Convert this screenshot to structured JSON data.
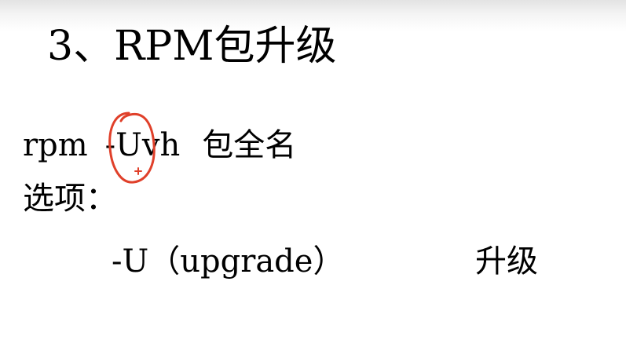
{
  "slide": {
    "title": "3、RPM包升级",
    "command": {
      "program": "rpm",
      "flags": "-Uvh",
      "argument": "包全名"
    },
    "options_label": "选项：",
    "option": {
      "flag": "-U（upgrade）",
      "description": "升级"
    },
    "annotation_color": "#e0402a"
  }
}
